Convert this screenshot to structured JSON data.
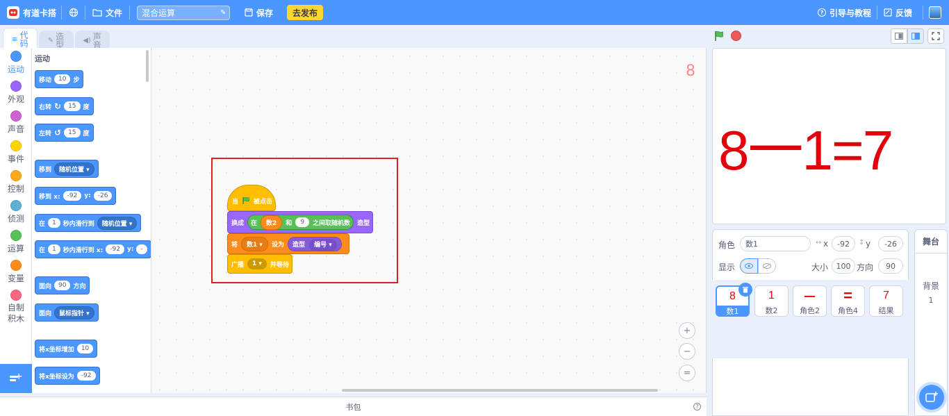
{
  "app": {
    "name": "有道卡搭"
  },
  "menu": {
    "file": "文件",
    "save": "保存",
    "publish": "去发布",
    "guide": "引导与教程",
    "feedback": "反馈"
  },
  "project": {
    "title": "混合运算"
  },
  "tabs": [
    "代码",
    "造型",
    "声音"
  ],
  "categories": [
    {
      "label": "运动",
      "color": "#4c97ff"
    },
    {
      "label": "外观",
      "color": "#9966ff"
    },
    {
      "label": "声音",
      "color": "#cf63cf"
    },
    {
      "label": "事件",
      "color": "#ffd500"
    },
    {
      "label": "控制",
      "color": "#ffab19"
    },
    {
      "label": "侦测",
      "color": "#5cb1d6"
    },
    {
      "label": "运算",
      "color": "#59c059"
    },
    {
      "label": "变量",
      "color": "#ff8c1a"
    },
    {
      "label": "自制积木",
      "color": "#ff6680"
    }
  ],
  "palette": {
    "title": "运动",
    "move": {
      "a": "移动",
      "v": "10",
      "b": "步"
    },
    "turn_right": {
      "a": "右转",
      "v": "15",
      "b": "度"
    },
    "turn_left": {
      "a": "左转",
      "v": "15",
      "b": "度"
    },
    "goto": {
      "a": "移到",
      "v": "随机位置"
    },
    "goto_xy": {
      "a": "移到 x:",
      "x": "-92",
      "b": "y:",
      "y": "-26"
    },
    "glide": {
      "a": "在",
      "v": "1",
      "b": "秒内滑行到",
      "c": "随机位置"
    },
    "glide_xy": {
      "a": "在",
      "v": "1",
      "b": "秒内滑行到 x:",
      "x": "-92",
      "c": "y:"
    },
    "point_dir": {
      "a": "面向",
      "v": "90",
      "b": "方向"
    },
    "point_to": {
      "a": "面向",
      "v": "鼠标指针"
    },
    "change_x": {
      "a": "将x坐标增加",
      "v": "10"
    },
    "set_x": {
      "a": "将x坐标设为",
      "v": "-92"
    }
  },
  "script": {
    "hat": {
      "a": "当",
      "b": "被点击"
    },
    "switch": {
      "a": "换成",
      "rand_a": "在",
      "var": "数2",
      "and": "和",
      "num": "9",
      "rand_b": "之间取随机数",
      "b": "造型"
    },
    "setvar": {
      "a": "将",
      "var": "数1",
      "b": "设为",
      "c": "造型",
      "d": "编号"
    },
    "broadcast": {
      "a": "广播",
      "v": "1",
      "b": "并等待"
    }
  },
  "workspace": {
    "sprite_number": "8"
  },
  "zoom": {
    "in": "+",
    "out": "−",
    "reset": "="
  },
  "backpack": {
    "label": "书包",
    "help": "?"
  },
  "stage": {
    "equation": "8一1=7"
  },
  "sprite_info": {
    "sprite_label": "角色",
    "sprite_name": "数1",
    "x_label": "x",
    "x": "-92",
    "y_label": "y",
    "y": "-26",
    "show_label": "显示",
    "size_label": "大小",
    "size": "100",
    "direction_label": "方向",
    "direction": "90"
  },
  "sprites": [
    {
      "glyph": "8",
      "name": "数1"
    },
    {
      "glyph": "1",
      "name": "数2"
    },
    {
      "glyph": "一",
      "name": "角色2"
    },
    {
      "glyph": "=",
      "name": "角色4"
    },
    {
      "glyph": "7",
      "name": "结果"
    }
  ],
  "stage_pane": {
    "title": "舞台",
    "label": "背景",
    "count": "1"
  }
}
